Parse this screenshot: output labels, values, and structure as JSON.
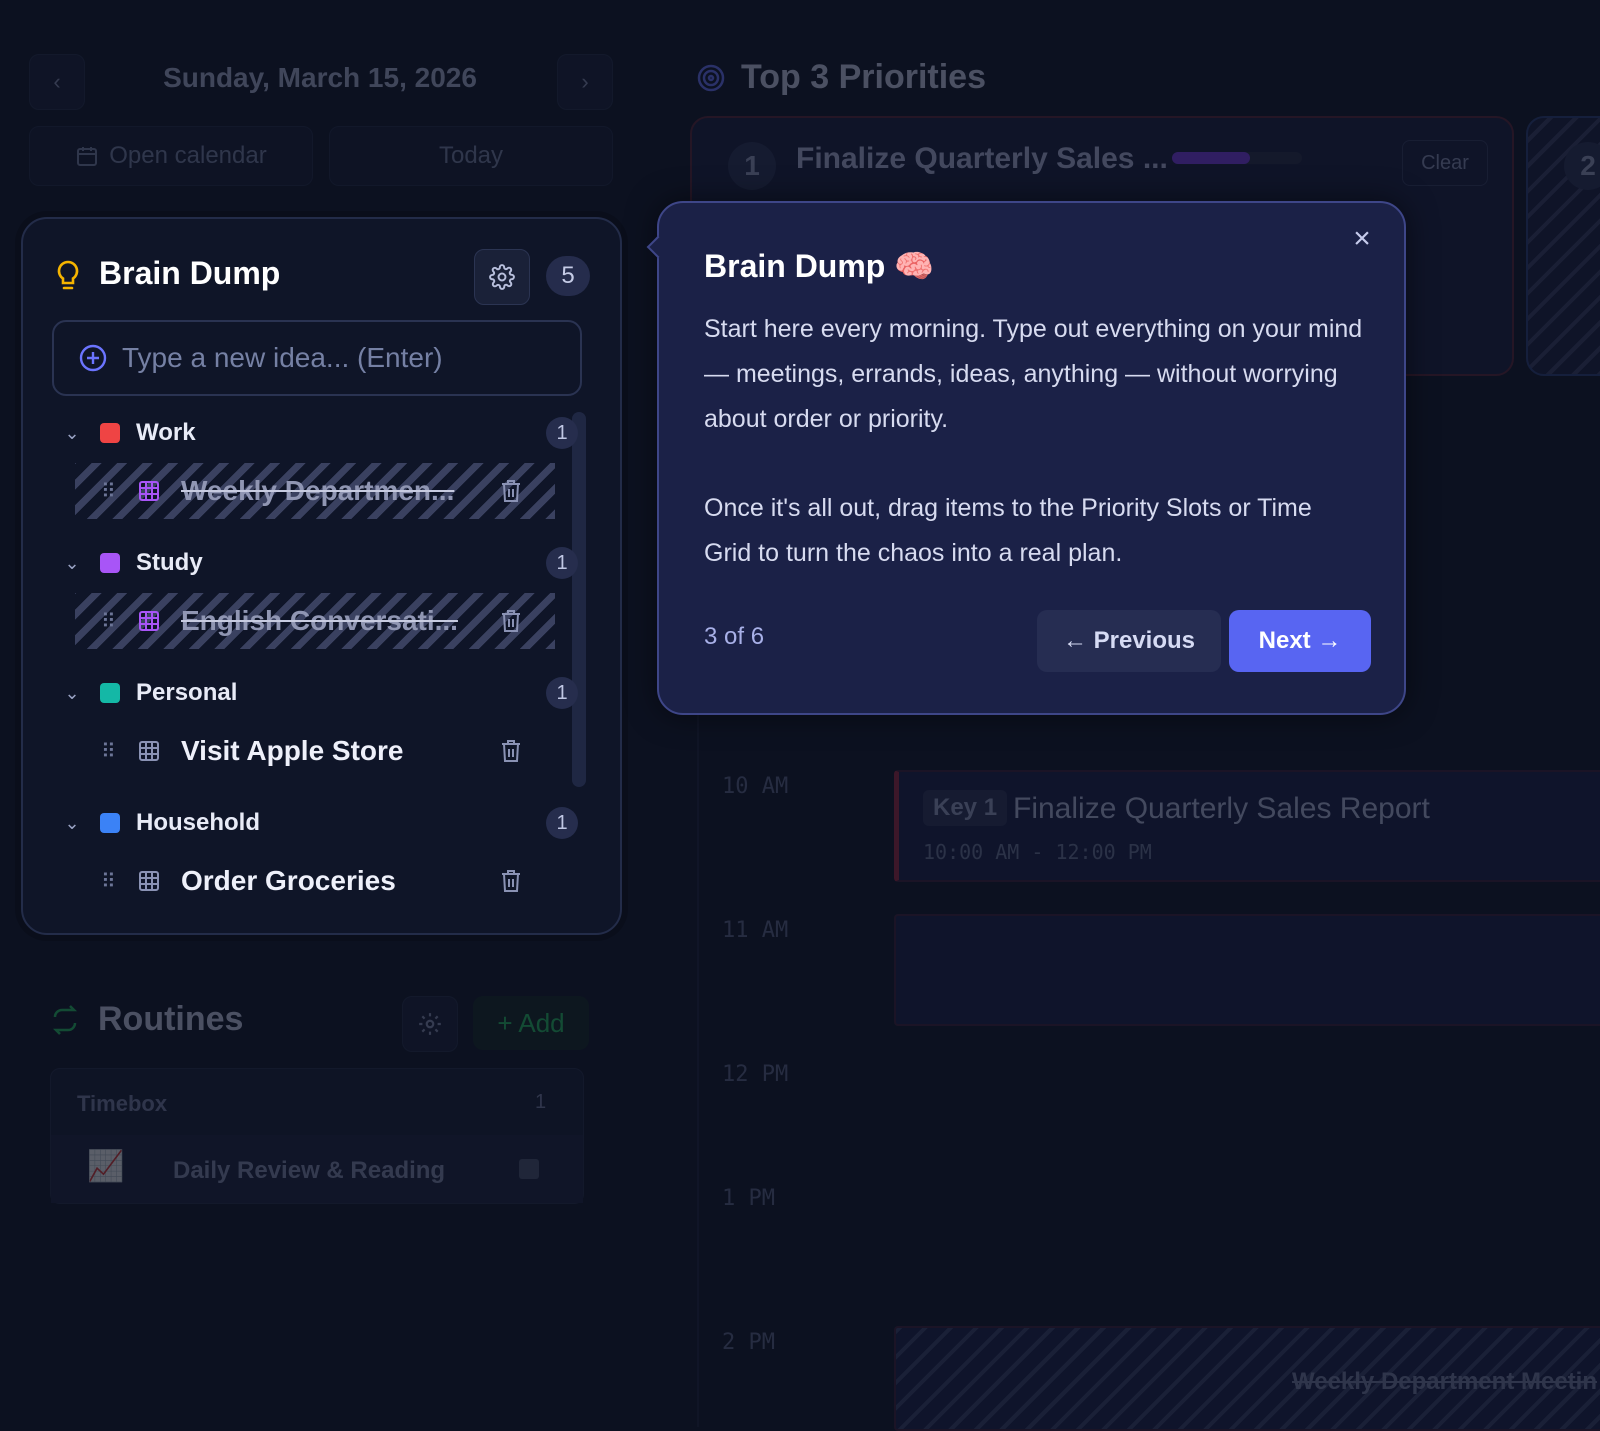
{
  "date_nav": {
    "date": "Sunday, March 15, 2026",
    "open_calendar": "Open calendar",
    "today": "Today"
  },
  "priorities": {
    "title": "Top 3 Priorities",
    "slot1": {
      "number": "1",
      "task": "Finalize Quarterly Sales ...",
      "progress": 0.6,
      "clear": "Clear"
    },
    "slot2": {
      "number": "2"
    }
  },
  "brain_dump": {
    "title": "Brain Dump",
    "count": "5",
    "input_placeholder": "Type a new idea... (Enter)",
    "categories": [
      {
        "name": "Work",
        "count": "1",
        "color": "#ef4444",
        "tasks": [
          {
            "label": "Weekly Departmen...",
            "done": true
          }
        ]
      },
      {
        "name": "Study",
        "count": "1",
        "color": "#a855f7",
        "tasks": [
          {
            "label": "English Conversati...",
            "done": true
          }
        ]
      },
      {
        "name": "Personal",
        "count": "1",
        "color": "#14b8a6",
        "tasks": [
          {
            "label": "Visit Apple Store",
            "done": false
          }
        ]
      },
      {
        "name": "Household",
        "count": "1",
        "color": "#3b82f6",
        "tasks": [
          {
            "label": "Order Groceries",
            "done": false
          }
        ]
      }
    ]
  },
  "routines": {
    "title": "Routines",
    "add": "+ Add",
    "group": "Timebox",
    "group_count": "1",
    "item": "Daily Review & Reading"
  },
  "timeline": {
    "hours": [
      "10 AM",
      "11 AM",
      "12 PM",
      "1 PM",
      "2 PM"
    ],
    "event1": {
      "badge": "Key 1",
      "title": "Finalize Quarterly Sales Report",
      "time": "10:00 AM - 12:00 PM"
    },
    "event2": {
      "title": "Weekly Department Meetin"
    }
  },
  "tour": {
    "title": "Brain Dump 🧠",
    "paragraph1": "Start here every morning. Type out everything on your mind — meetings, errands, ideas, anything — without worrying about order or priority.",
    "paragraph2": "Once it's all out, drag items to the Priority Slots or Time Grid to turn the chaos into a real plan.",
    "step": "3 of 6",
    "prev": "← Previous",
    "next": "Next →",
    "close": "×"
  },
  "colors": {
    "accent": "#5865f2",
    "bulb": "#f5b400"
  }
}
